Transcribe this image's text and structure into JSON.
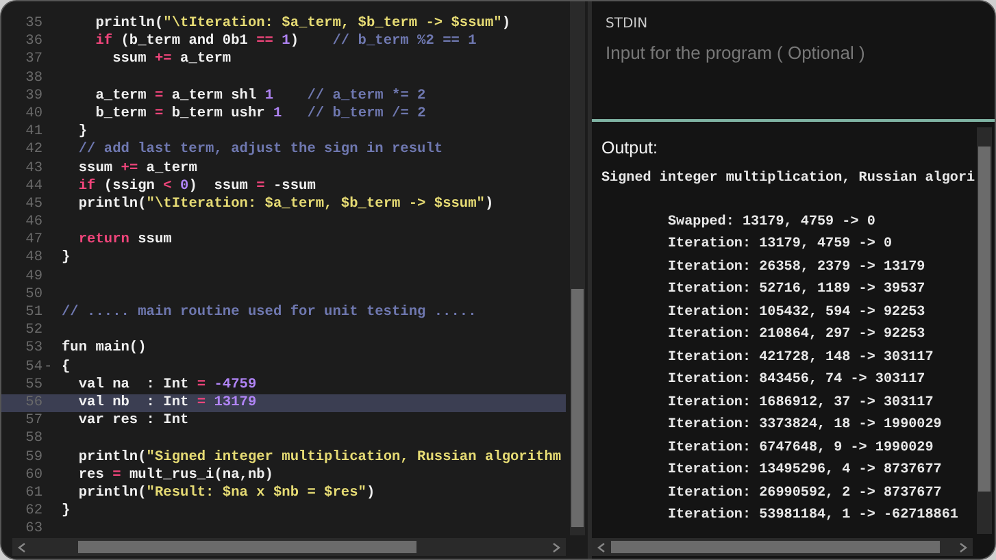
{
  "editor": {
    "lines": [
      {
        "number": "35",
        "current": false,
        "tokens": [
          {
            "kind": "plain",
            "text": "    println("
          },
          {
            "kind": "string",
            "text": "\"\\tIteration: $a_term, $b_term -> $ssum\""
          },
          {
            "kind": "plain",
            "text": ")"
          }
        ]
      },
      {
        "number": "36",
        "current": false,
        "tokens": [
          {
            "kind": "keyword",
            "text": "    if"
          },
          {
            "kind": "plain",
            "text": " (b_term and 0b1 "
          },
          {
            "kind": "operator",
            "text": "=="
          },
          {
            "kind": "number",
            "text": " 1"
          },
          {
            "kind": "plain",
            "text": ")    "
          },
          {
            "kind": "comment",
            "text": "// b_term %2 == 1"
          }
        ]
      },
      {
        "number": "37",
        "current": false,
        "tokens": [
          {
            "kind": "plain",
            "text": "      ssum "
          },
          {
            "kind": "operator",
            "text": "+="
          },
          {
            "kind": "plain",
            "text": " a_term"
          }
        ]
      },
      {
        "number": "38",
        "current": false
      },
      {
        "number": "39",
        "current": false,
        "tokens": [
          {
            "kind": "plain",
            "text": "    a_term "
          },
          {
            "kind": "operator",
            "text": "="
          },
          {
            "kind": "plain",
            "text": " a_term shl "
          },
          {
            "kind": "number",
            "text": "1"
          },
          {
            "kind": "comment",
            "text": "    // a_term *= 2"
          }
        ]
      },
      {
        "number": "40",
        "current": false,
        "tokens": [
          {
            "kind": "plain",
            "text": "    b_term "
          },
          {
            "kind": "operator",
            "text": "="
          },
          {
            "kind": "plain",
            "text": " b_term ushr "
          },
          {
            "kind": "number",
            "text": "1"
          },
          {
            "kind": "comment",
            "text": "   // b_term /= 2"
          }
        ]
      },
      {
        "number": "41",
        "current": false,
        "tokens": [
          {
            "kind": "plain",
            "text": "  }"
          }
        ]
      },
      {
        "number": "42",
        "current": false,
        "tokens": [
          {
            "kind": "comment",
            "text": "  // add last term, adjust the sign in result"
          }
        ]
      },
      {
        "number": "43",
        "current": false,
        "tokens": [
          {
            "kind": "plain",
            "text": "  ssum "
          },
          {
            "kind": "operator",
            "text": "+="
          },
          {
            "kind": "plain",
            "text": " a_term"
          }
        ]
      },
      {
        "number": "44",
        "current": false,
        "tokens": [
          {
            "kind": "keyword",
            "text": "  if"
          },
          {
            "kind": "plain",
            "text": " (ssign "
          },
          {
            "kind": "operator",
            "text": "<"
          },
          {
            "kind": "number",
            "text": " 0"
          },
          {
            "kind": "plain",
            "text": ")  ssum "
          },
          {
            "kind": "operator",
            "text": "="
          },
          {
            "kind": "plain",
            "text": " -ssum"
          }
        ]
      },
      {
        "number": "45",
        "current": false,
        "tokens": [
          {
            "kind": "plain",
            "text": "  println("
          },
          {
            "kind": "string",
            "text": "\"\\tIteration: $a_term, $b_term -> $ssum\""
          },
          {
            "kind": "plain",
            "text": ")"
          }
        ]
      },
      {
        "number": "46",
        "current": false
      },
      {
        "number": "47",
        "current": false,
        "tokens": [
          {
            "kind": "keyword",
            "text": "  return"
          },
          {
            "kind": "plain",
            "text": " ssum"
          }
        ]
      },
      {
        "number": "48",
        "current": false,
        "tokens": [
          {
            "kind": "plain",
            "text": "}"
          }
        ]
      },
      {
        "number": "49",
        "current": false
      },
      {
        "number": "50",
        "current": false
      },
      {
        "number": "51",
        "current": false,
        "tokens": [
          {
            "kind": "comment",
            "text": "// ..... main routine used for unit testing ....."
          }
        ]
      },
      {
        "number": "52",
        "current": false
      },
      {
        "number": "53",
        "current": false,
        "tokens": [
          {
            "kind": "plain",
            "text": "fun main()"
          }
        ]
      },
      {
        "number": "54",
        "current": false,
        "fold_marker": "-",
        "tokens": [
          {
            "kind": "plain",
            "text": "{"
          }
        ]
      },
      {
        "number": "55",
        "current": false,
        "tokens": [
          {
            "kind": "plain",
            "text": "  val na  : Int "
          },
          {
            "kind": "operator",
            "text": "="
          },
          {
            "kind": "number",
            "text": " -4759"
          }
        ]
      },
      {
        "number": "56",
        "current": true,
        "tokens": [
          {
            "kind": "plain",
            "text": "  val nb  : Int "
          },
          {
            "kind": "operator",
            "text": "="
          },
          {
            "kind": "number",
            "text": " 13179"
          }
        ]
      },
      {
        "number": "57",
        "current": false,
        "tokens": [
          {
            "kind": "plain",
            "text": "  var res : Int"
          }
        ]
      },
      {
        "number": "58",
        "current": false
      },
      {
        "number": "59",
        "current": false,
        "tokens": [
          {
            "kind": "plain",
            "text": "  println("
          },
          {
            "kind": "string",
            "text": "\"Signed integer multiplication, Russian algorithm"
          }
        ]
      },
      {
        "number": "60",
        "current": false,
        "tokens": [
          {
            "kind": "plain",
            "text": "  res "
          },
          {
            "kind": "operator",
            "text": "="
          },
          {
            "kind": "plain",
            "text": " mult_rus_i(na,nb)"
          }
        ]
      },
      {
        "number": "61",
        "current": false,
        "tokens": [
          {
            "kind": "plain",
            "text": "  println("
          },
          {
            "kind": "string",
            "text": "\"Result: $na x $nb = $res\""
          },
          {
            "kind": "plain",
            "text": ")"
          }
        ]
      },
      {
        "number": "62",
        "current": false,
        "tokens": [
          {
            "kind": "plain",
            "text": "}"
          }
        ]
      },
      {
        "number": "63",
        "current": false
      }
    ]
  },
  "stdin": {
    "label": "STDIN",
    "placeholder": "Input for the program ( Optional )"
  },
  "output": {
    "title": "Output:",
    "lines": [
      "Signed integer multiplication, Russian algori",
      "\tSwapped: 13179, 4759 -> 0",
      "\tIteration: 13179, 4759 -> 0",
      "\tIteration: 26358, 2379 -> 13179",
      "\tIteration: 52716, 1189 -> 39537",
      "\tIteration: 105432, 594 -> 92253",
      "\tIteration: 210864, 297 -> 92253",
      "\tIteration: 421728, 148 -> 303117",
      "\tIteration: 843456, 74 -> 303117",
      "\tIteration: 1686912, 37 -> 303117",
      "\tIteration: 3373824, 18 -> 1990029",
      "\tIteration: 6747648, 9 -> 1990029",
      "\tIteration: 13495296, 4 -> 8737677",
      "\tIteration: 26990592, 2 -> 8737677",
      "\tIteration: 53981184, 1 -> -62718861"
    ]
  }
}
